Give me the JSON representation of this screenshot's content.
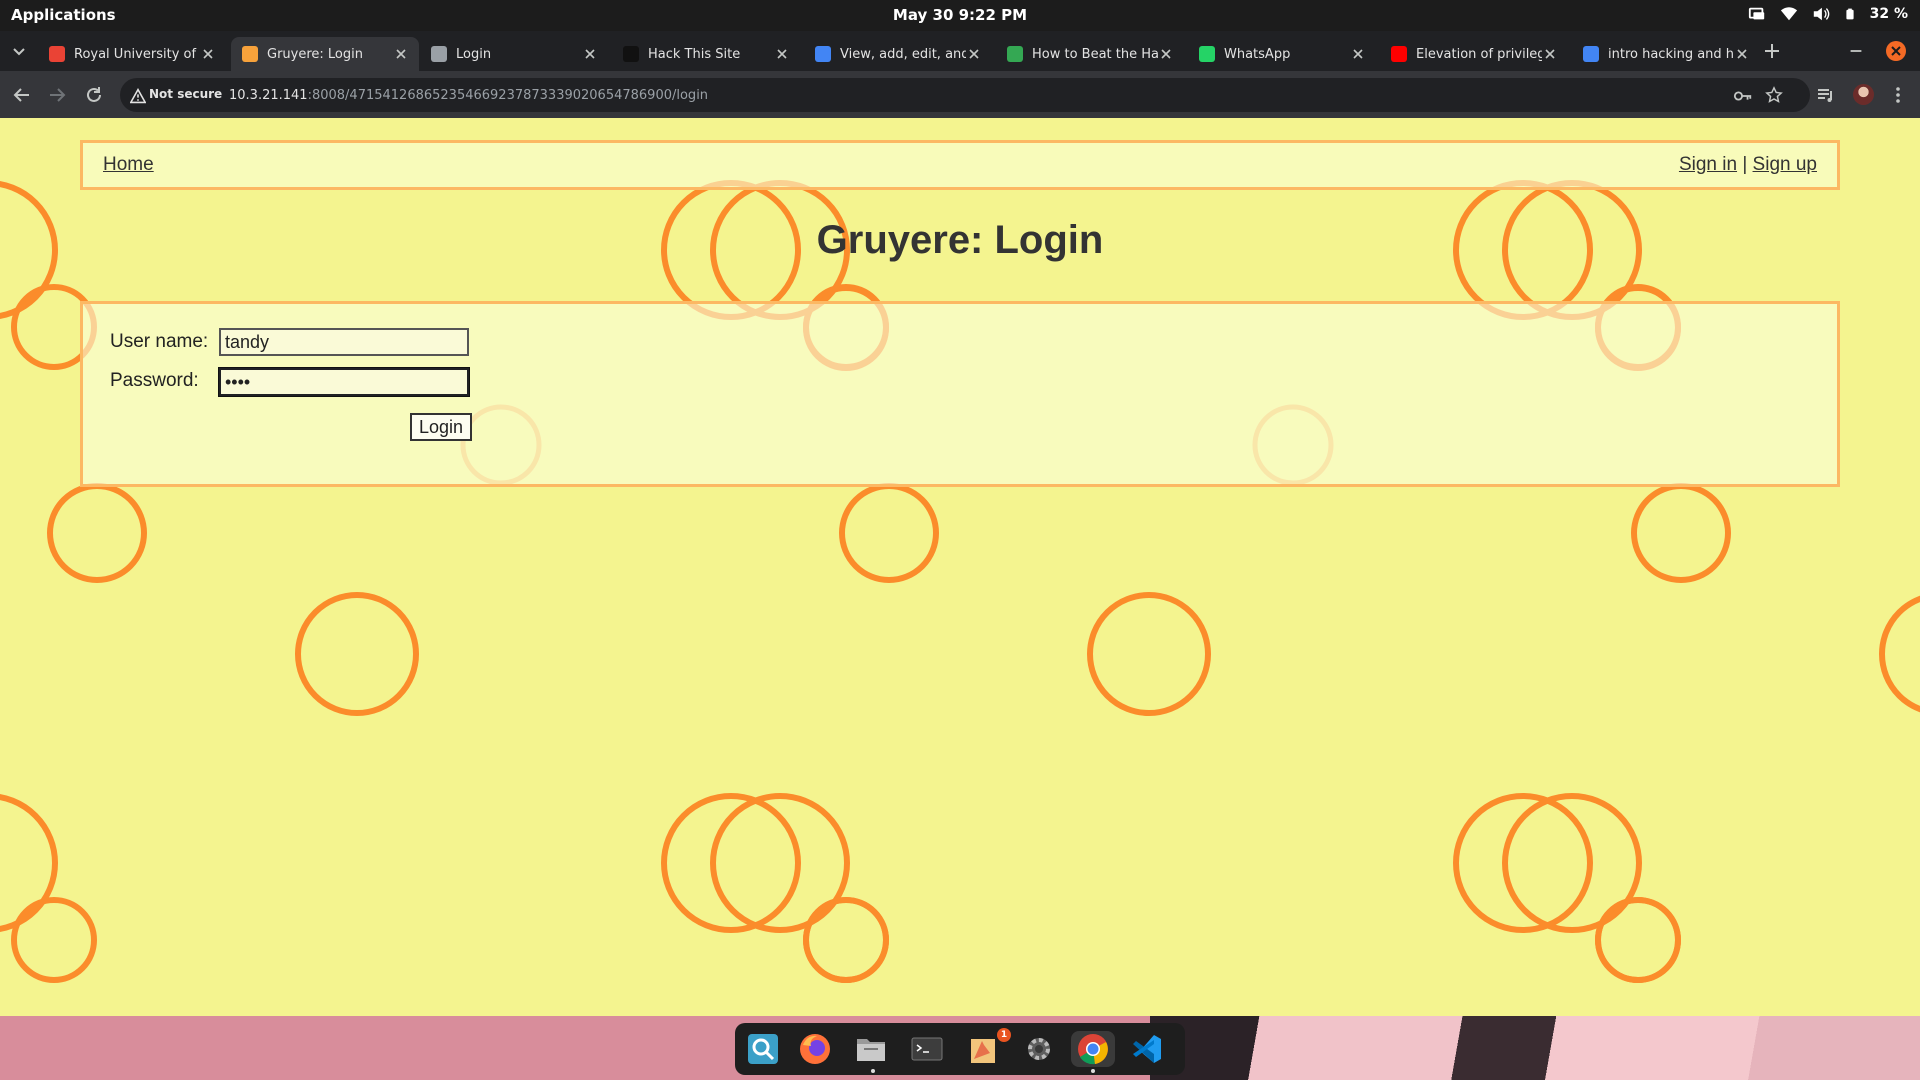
{
  "system_bar": {
    "applications_label": "Applications",
    "clock": "May 30   9:22 PM",
    "battery": "32 %"
  },
  "tabs": [
    {
      "title": "Royal University of B",
      "favicon": "gmail-icon",
      "color": "#ea4335",
      "active": false
    },
    {
      "title": "Gruyere: Login",
      "favicon": "gruyere-cheese-icon",
      "color": "#f7a23b",
      "active": true
    },
    {
      "title": "Login",
      "favicon": "globe-icon",
      "color": "#9aa0a6",
      "active": false
    },
    {
      "title": "Hack This Site",
      "favicon": "hackthissite-icon",
      "color": "#111111",
      "active": false
    },
    {
      "title": "View, add, edit, and",
      "favicon": "chrome-icon",
      "color": "#4285f4",
      "active": false
    },
    {
      "title": "How to Beat the Hac",
      "favicon": "meet-icon",
      "color": "#34a853",
      "active": false
    },
    {
      "title": "WhatsApp",
      "favicon": "whatsapp-icon",
      "color": "#25d366",
      "active": false
    },
    {
      "title": "Elevation of privileg",
      "favicon": "youtube-icon",
      "color": "#ff0000",
      "active": false
    },
    {
      "title": "intro hacking and ha",
      "favicon": "google-docs-icon",
      "color": "#4285f4",
      "active": false
    }
  ],
  "omnibox": {
    "security_label": "Not secure",
    "url_host": "10.3.21.141",
    "url_rest": ":8008/471541268652354669237873339020654786900/login"
  },
  "page": {
    "nav_home": "Home",
    "nav_signin": "Sign in",
    "nav_separator": " | ",
    "nav_signup": "Sign up",
    "title": "Gruyere: Login",
    "username_label": "User name:",
    "username_value": "tandy",
    "password_label": "Password:",
    "password_value": "••••",
    "login_button": "Login"
  },
  "dock": {
    "apps": [
      "search-icon",
      "firefox-icon",
      "files-icon",
      "terminal-icon",
      "text-editor-icon",
      "settings-icon",
      "chrome-icon",
      "vscode-icon"
    ],
    "notification_badge": "1"
  },
  "colors": {
    "page_bg": "#f4f48f",
    "bubble_orange": "#fb8c2b",
    "panel_border": "#fcb863"
  }
}
